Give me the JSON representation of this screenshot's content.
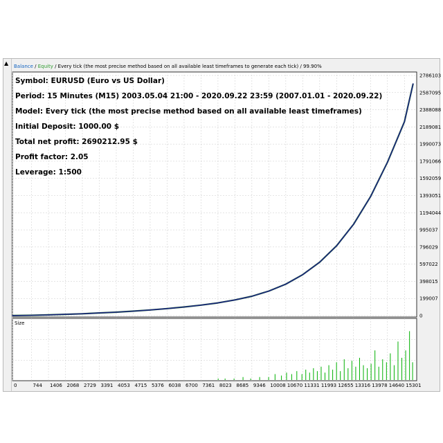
{
  "header": {
    "balance_label": "Balance",
    "separator": " / ",
    "equity_label": "Equity",
    "description": " / Every tick (the most precise method based on all available least timeframes to generate each tick) / 99.90%"
  },
  "info_lines": [
    "Symbol: EURUSD (Euro vs US Dollar)",
    "Period: 15 Minutes (M15) 2003.05.04 21:00 - 2020.09.22 23:59 (2007.01.01 - 2020.09.22)",
    "Model: Every tick (the most precise method based on all available least timeframes)",
    "Initial Deposit: 1000.00 $",
    "Total net profit: 2690212.95 $",
    "Profit factor: 2.05",
    "Leverage: 1:500"
  ],
  "colors": {
    "balance": "#1a237e",
    "equity": "#2e7d32",
    "header_balance": "#1565c0",
    "header_equity": "#2e9a2e",
    "volume": "#00b000",
    "grid": "#c8c8c8"
  },
  "chart_data": [
    {
      "type": "line",
      "series": [
        {
          "name": "Balance",
          "x": [
            0,
            744,
            1406,
            2068,
            2729,
            3391,
            4053,
            4715,
            5376,
            6038,
            6700,
            7361,
            8023,
            8685,
            9346,
            10008,
            10670,
            11331,
            11993,
            12655,
            13316,
            13978,
            14640,
            15301,
            15640
          ],
          "values": [
            1000,
            4000,
            9000,
            15000,
            22000,
            31000,
            40000,
            52000,
            66000,
            82000,
            100000,
            122000,
            148000,
            182000,
            225000,
            285000,
            365000,
            475000,
            620000,
            810000,
            1060000,
            1380000,
            1780000,
            2250000,
            2690000
          ]
        }
      ],
      "y_ticks": [
        "2786103",
        "2587095",
        "2388088",
        "2189081",
        "1990073",
        "1791066",
        "1592059",
        "1393051",
        "1194044",
        "995037",
        "796029",
        "597022",
        "398015",
        "199007",
        "0"
      ],
      "ylim": [
        0,
        2786103
      ],
      "xlim": [
        0,
        15780
      ],
      "grid": true
    },
    {
      "type": "bar",
      "title": "Size",
      "x_ticks": [
        "0",
        "744",
        "1406",
        "2068",
        "2729",
        "3391",
        "4053",
        "4715",
        "5376",
        "6038",
        "6700",
        "7361",
        "8023",
        "8685",
        "9346",
        "10008",
        "10670",
        "11331",
        "11993",
        "12655",
        "13316",
        "13978",
        "14640",
        "15301"
      ],
      "x": [
        8030,
        8300,
        8650,
        9000,
        9300,
        9650,
        10000,
        10250,
        10500,
        10700,
        10900,
        11100,
        11300,
        11450,
        11600,
        11750,
        11900,
        12050,
        12200,
        12350,
        12500,
        12650,
        12800,
        12950,
        13100,
        13250,
        13400,
        13550,
        13700,
        13850,
        14000,
        14150,
        14300,
        14450,
        14600,
        14750,
        14900,
        15050,
        15200,
        15350,
        15500,
        15620
      ],
      "values": [
        1,
        1,
        1,
        2,
        1,
        2,
        2,
        4,
        3,
        5,
        4,
        6,
        4,
        7,
        5,
        8,
        6,
        9,
        5,
        10,
        7,
        12,
        6,
        14,
        8,
        13,
        9,
        15,
        10,
        8,
        11,
        20,
        9,
        14,
        12,
        18,
        10,
        26,
        15,
        20,
        33,
        12
      ],
      "ylim": [
        0,
        36
      ],
      "grid": true
    }
  ]
}
